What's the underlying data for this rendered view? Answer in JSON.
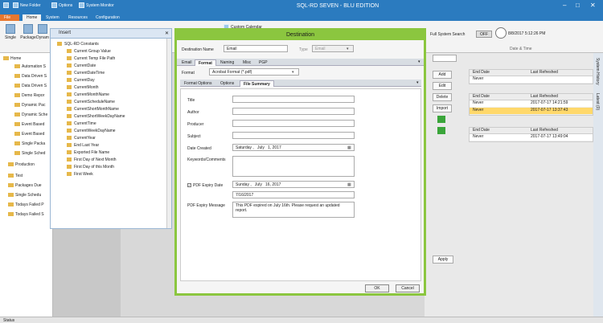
{
  "app": {
    "title": "SQL-RD SEVEN - BLU EDITION",
    "quick_access": [
      "New Folder",
      "Options",
      "System Monitor"
    ],
    "tabs": [
      "File",
      "Home",
      "System",
      "Resources",
      "Configuration"
    ],
    "ribbon_buttons": [
      "Single",
      "Package",
      "Dynam"
    ],
    "calendar_label": "Custom Calendar",
    "system_search": "Full System Search",
    "toggle": "OFF",
    "datetime": "8/8/2017 5:12:26 PM",
    "datetime_group": "Date & Time"
  },
  "left_tree": {
    "root": "Home",
    "items": [
      "Automation S",
      "Data Driven S",
      "Data Driven S",
      "Demo Repor",
      "Dynamic Pac",
      "Dynamic Sche",
      "Event Based",
      "Event Based",
      "Single Packa",
      "Single Sched",
      "Production",
      "Test",
      "Packages Due",
      "Single Schedu",
      "Todays Failed P",
      "Todays Failed S"
    ]
  },
  "insert_panel": {
    "title": "Insert",
    "root": "SQL-RD Constants",
    "items": [
      "Current Group Value",
      "Current Temp File Path",
      "CurrentDate",
      "CurrentDateTime",
      "CurrentDay",
      "CurrentMonth",
      "CurrentMonthName",
      "CurrentScheduleName",
      "CurrentShortMonthName",
      "CurrentShortWeekDayName",
      "CurrentTime",
      "CurrentWeekDayName",
      "CurrentYear",
      "End Last Year",
      "Exported File Name",
      "First Day of Next Month",
      "First Day of this Month",
      "First Week"
    ]
  },
  "right": {
    "headers": [
      "End Date",
      "Last Refreshed"
    ],
    "rows": [
      {
        "end": "Never",
        "refreshed": ""
      },
      {
        "end": "Never",
        "refreshed": "2017-07-17 14:21:59"
      },
      {
        "end": "Never",
        "refreshed": "2017-07-17 13:37:43"
      },
      {
        "end": "Never",
        "refreshed": "2017-07-17 13:49:04"
      }
    ],
    "buttons": [
      "Add",
      "Edit",
      "Delete",
      "Import"
    ],
    "apply": "Apply",
    "side_tabs": [
      "System History",
      "Latest (0)"
    ]
  },
  "status": "Status",
  "dialog": {
    "title": "Destination",
    "dest_name_label": "Destination Name",
    "dest_name": "Email",
    "type_label": "Type",
    "type_value": "Email",
    "tabs": [
      "Email",
      "Format",
      "Naming",
      "Misc",
      "PGP"
    ],
    "format_label": "Format",
    "format_value": "Acrobat Format (*.pdf)",
    "subtabs": [
      "Format Options",
      "Options",
      "File Summary"
    ],
    "fields": {
      "title": "Title",
      "author": "Author",
      "producer": "Producer",
      "subject": "Subject",
      "date_created": "Date Created",
      "keywords": "Keywords/Comments",
      "pdf_expiry": "PDF Expiry Date",
      "expiry_message_label": "PDF Expiry Message"
    },
    "date_created": {
      "day": "Saturday",
      "month": "July",
      "date": "1, 2017"
    },
    "expiry_date": {
      "day": "Sunday",
      "month": "July",
      "date": "16, 2017"
    },
    "expiry_value": "7/16/2017",
    "expiry_message": "This PDF expired on July 16th. Please request an updated report.",
    "ok": "OK",
    "cancel": "Cancel"
  }
}
